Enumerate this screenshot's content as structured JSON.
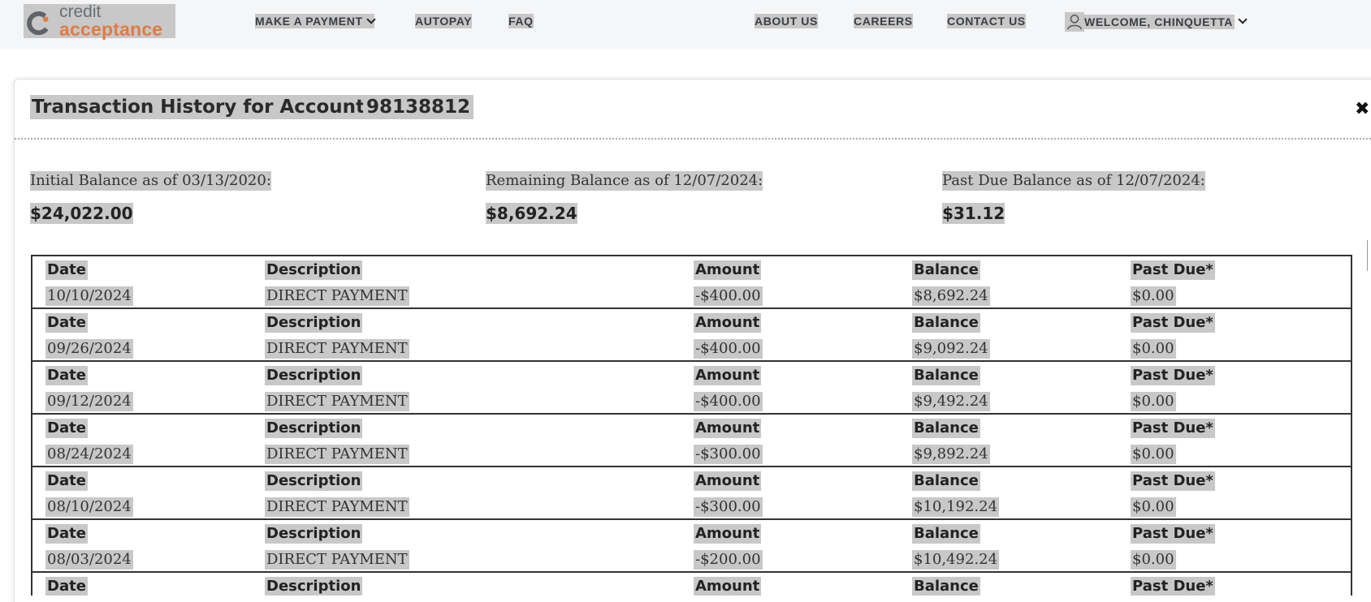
{
  "brand": {
    "name_line1": "credit",
    "name_line2": "acceptance",
    "accent": "#e07b45",
    "gray": "#6b6f74"
  },
  "nav": {
    "make_payment": "MAKE A PAYMENT",
    "autopay": "AUTOPAY",
    "faq": "FAQ",
    "about": "ABOUT US",
    "careers": "CAREERS",
    "contact": "CONTACT US",
    "welcome": "WELCOME, CHINQUETTA"
  },
  "modal": {
    "title": "Transaction History for Account",
    "account_number": "98138812",
    "close_icon": "close-icon"
  },
  "summary": {
    "initial_label": "Initial Balance as of 03/13/2020:",
    "initial_value": "$24,022.00",
    "remaining_label": "Remaining Balance as of 12/07/2024:",
    "remaining_value": "$8,692.24",
    "past_due_label": "Past Due Balance as of 12/07/2024:",
    "past_due_value": "$31.12"
  },
  "table": {
    "headers": {
      "date": "Date",
      "description": "Description",
      "amount": "Amount",
      "balance": "Balance",
      "past_due": "Past Due*"
    },
    "rows": [
      {
        "date": "10/10/2024",
        "description": "DIRECT PAYMENT",
        "amount": "-$400.00",
        "balance": "$8,692.24",
        "past_due": "$0.00"
      },
      {
        "date": "09/26/2024",
        "description": "DIRECT PAYMENT",
        "amount": "-$400.00",
        "balance": "$9,092.24",
        "past_due": "$0.00"
      },
      {
        "date": "09/12/2024",
        "description": "DIRECT PAYMENT",
        "amount": "-$400.00",
        "balance": "$9,492.24",
        "past_due": "$0.00"
      },
      {
        "date": "08/24/2024",
        "description": "DIRECT PAYMENT",
        "amount": "-$300.00",
        "balance": "$9,892.24",
        "past_due": "$0.00"
      },
      {
        "date": "08/10/2024",
        "description": "DIRECT PAYMENT",
        "amount": "-$300.00",
        "balance": "$10,192.24",
        "past_due": "$0.00"
      },
      {
        "date": "08/03/2024",
        "description": "DIRECT PAYMENT",
        "amount": "-$200.00",
        "balance": "$10,492.24",
        "past_due": "$0.00"
      },
      {
        "date": "",
        "description": "",
        "amount": "",
        "balance": "",
        "past_due": ""
      }
    ]
  }
}
